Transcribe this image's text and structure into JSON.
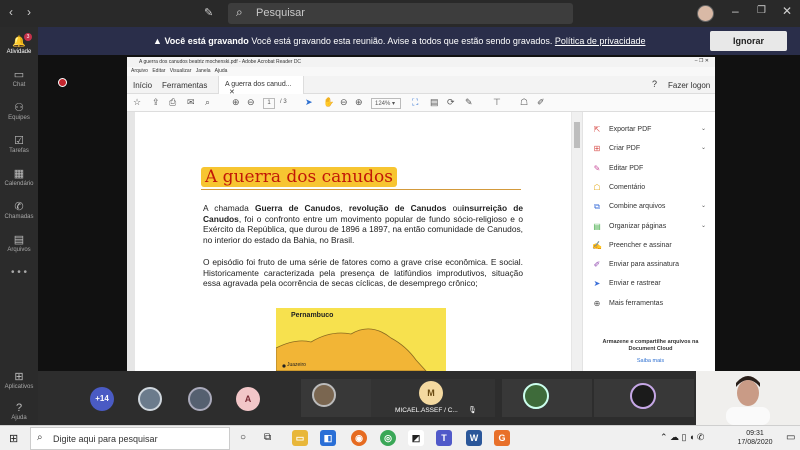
{
  "teams": {
    "search_placeholder": "Pesquisar",
    "rail": [
      {
        "label": "Atividade",
        "icon": "bell-icon",
        "badge": "3"
      },
      {
        "label": "Chat",
        "icon": "chat-icon"
      },
      {
        "label": "Equipes",
        "icon": "teams-icon"
      },
      {
        "label": "Tarefas",
        "icon": "tasks-icon"
      },
      {
        "label": "Calendário",
        "icon": "calendar-icon"
      },
      {
        "label": "Chamadas",
        "icon": "phone-icon"
      },
      {
        "label": "Arquivos",
        "icon": "files-icon"
      },
      {
        "label": "Aplicativos",
        "icon": "apps-icon"
      },
      {
        "label": "Ajuda",
        "icon": "help-icon"
      }
    ],
    "recording_banner": {
      "bold": "Você está gravando",
      "text": "Você está gravando esta reunião. Avise a todos que estão sendo gravados.",
      "link": "Política de privacidade",
      "button": "Ignorar"
    }
  },
  "acrobat": {
    "window_title": "A guerra dos canudos  beatriz mochenski.pdf - Adobe Acrobat Reader DC",
    "menu": [
      "Arquivo",
      "Editar",
      "Visualizar",
      "Janela",
      "Ajuda"
    ],
    "tabs": {
      "home": "Início",
      "tools": "Ferramentas",
      "doc": "A guerra dos canud..."
    },
    "sign_in": "Fazer logon",
    "page_current": "1",
    "page_total": "/ 3",
    "zoom": "124%",
    "sidebar": [
      {
        "label": "Exportar PDF",
        "icon": "export-pdf-icon",
        "color": "#d9534f",
        "chevron": true
      },
      {
        "label": "Criar PDF",
        "icon": "create-pdf-icon",
        "color": "#d9534f",
        "chevron": true
      },
      {
        "label": "Editar PDF",
        "icon": "edit-pdf-icon",
        "color": "#c94f9b",
        "chevron": false
      },
      {
        "label": "Comentário",
        "icon": "comment-icon",
        "color": "#e2a711",
        "chevron": false
      },
      {
        "label": "Combine arquivos",
        "icon": "combine-icon",
        "color": "#3b6fd8",
        "chevron": true
      },
      {
        "label": "Organizar páginas",
        "icon": "organize-icon",
        "color": "#4caf50",
        "chevron": true
      },
      {
        "label": "Preencher e assinar",
        "icon": "fill-sign-icon",
        "color": "#8e44ad",
        "chevron": false
      },
      {
        "label": "Enviar para assinatura",
        "icon": "send-sign-icon",
        "color": "#8e44ad",
        "chevron": false
      },
      {
        "label": "Enviar e rastrear",
        "icon": "send-track-icon",
        "color": "#3b6fd8",
        "chevron": false
      },
      {
        "label": "Mais ferramentas",
        "icon": "more-tools-icon",
        "color": "#555555",
        "chevron": false
      }
    ],
    "cloud_title": "Armazene e compartilhe arquivos na Document Cloud",
    "cloud_link": "Saiba mais"
  },
  "document": {
    "title": "A guerra dos canudos",
    "p1_a": "A chamada ",
    "p1_b": "Guerra de Canudos",
    "p1_c": ", ",
    "p1_d": "revolução de Canudos",
    "p1_e": " ou",
    "p1_f": "insurreição de Canudos",
    "p1_g": ",  foi o confronto entre um movimento popular de fundo sócio-religioso e o Exército da República, que durou de 1896 a 1897, na então comunidade de Canudos, no interior do estado da Bahia, no Brasil.",
    "p2": "O episódio foi fruto de uma série de fatores como a grave crise econômica. E social. Historicamente caracterizada pela presença de latifúndios improdutivos, situação essa agravada pela ocorrência de secas cíclicas, de desemprego crônico;",
    "map_label": "Pernambuco",
    "map_city": "Juazeiro"
  },
  "participants": {
    "overflow": "+14",
    "initial_a": "A",
    "initial_m": "M",
    "name": "MICAEL.ASSEF / C..."
  },
  "taskbar": {
    "search": "Digite aqui para pesquisar",
    "time": "09:31",
    "date": "17/08/2020"
  }
}
